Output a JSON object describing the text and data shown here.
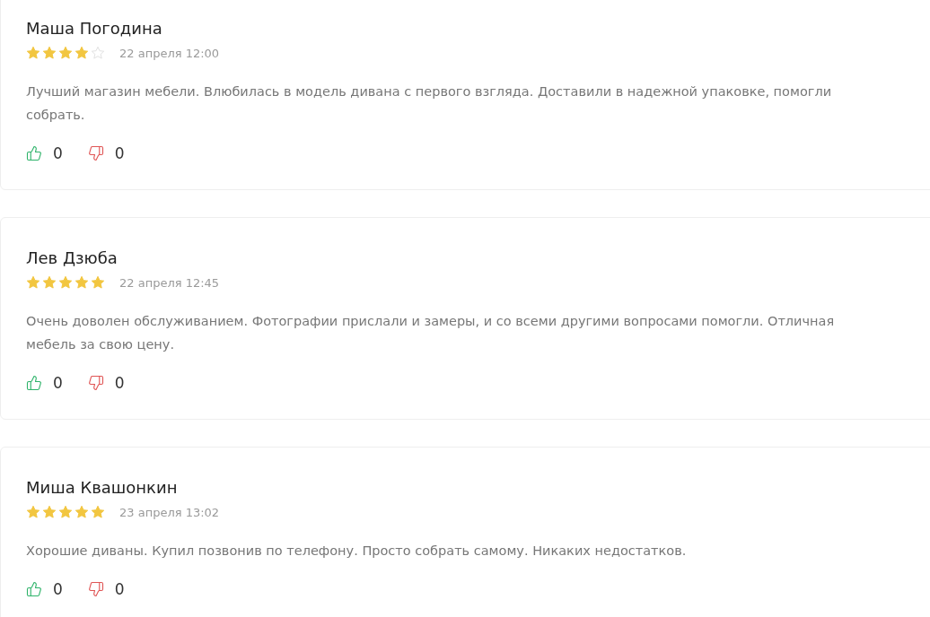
{
  "reviews": [
    {
      "author": "Маша Погодина",
      "stars": 4,
      "date": "22 апреля 12:00",
      "text": "Лучший магазин мебели. Влюбилась в модель дивана с первого взгляда. Доставили в надежной упаковке, помогли собрать.",
      "likes": "0",
      "dislikes": "0"
    },
    {
      "author": "Лев Дзюба",
      "stars": 5,
      "date": "22 апреля 12:45",
      "text": "Очень доволен обслуживанием. Фотографии прислали и замеры, и со всеми другими вопросами помогли. Отличная мебель за свою цену.",
      "likes": "0",
      "dislikes": "0"
    },
    {
      "author": "Миша Квашонкин",
      "stars": 5,
      "date": "23 апреля 13:02",
      "text": "Хорошие диваны. Купил позвонив по телефону. Просто собрать самому. Никаких недостатков.",
      "likes": "0",
      "dislikes": "0"
    }
  ]
}
